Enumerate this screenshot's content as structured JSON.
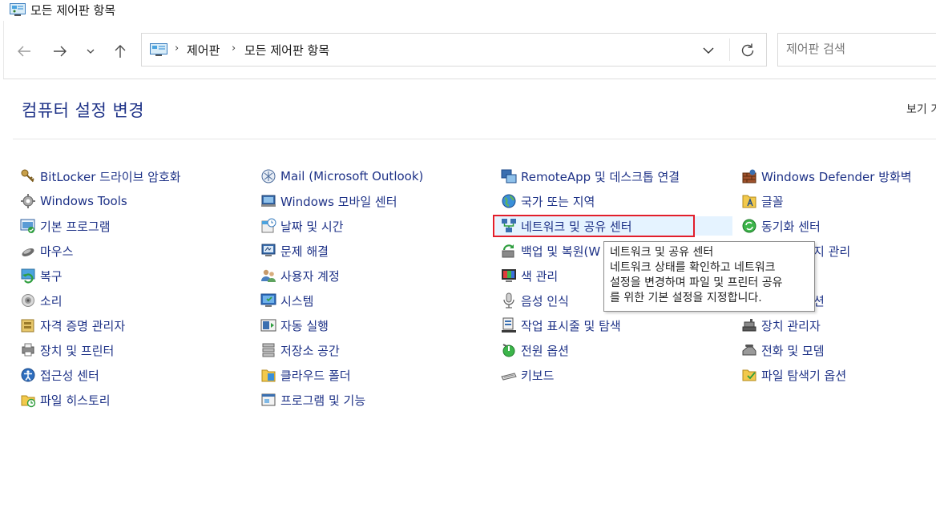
{
  "window": {
    "title": "모든 제어판 항목"
  },
  "address_bar": {
    "breadcrumbs": [
      "제어판",
      "모든 제어판 항목"
    ],
    "separator": "›"
  },
  "search": {
    "placeholder": "제어판 검색"
  },
  "page": {
    "heading": "컴퓨터 설정 변경",
    "view_by_label": "보기 기"
  },
  "columns": [
    {
      "items": [
        {
          "label": "BitLocker 드라이브 암호화",
          "icon": "bitlocker-key-icon"
        },
        {
          "label": "Windows Tools",
          "icon": "windows-tools-icon"
        },
        {
          "label": "기본 프로그램",
          "icon": "default-programs-icon"
        },
        {
          "label": "마우스",
          "icon": "mouse-icon"
        },
        {
          "label": "복구",
          "icon": "recovery-icon"
        },
        {
          "label": "소리",
          "icon": "sound-icon"
        },
        {
          "label": "자격 증명 관리자",
          "icon": "credential-manager-icon"
        },
        {
          "label": "장치 및 프린터",
          "icon": "devices-printers-icon"
        },
        {
          "label": "접근성 센터",
          "icon": "ease-of-access-icon"
        },
        {
          "label": "파일 히스토리",
          "icon": "file-history-icon"
        }
      ]
    },
    {
      "items": [
        {
          "label": "Mail (Microsoft Outlook)",
          "icon": "mail-icon"
        },
        {
          "label": "Windows 모바일 센터",
          "icon": "mobility-center-icon"
        },
        {
          "label": "날짜 및 시간",
          "icon": "date-time-icon"
        },
        {
          "label": "문제 해결",
          "icon": "troubleshooting-icon"
        },
        {
          "label": "사용자 계정",
          "icon": "user-accounts-icon"
        },
        {
          "label": "시스템",
          "icon": "system-icon"
        },
        {
          "label": "자동 실행",
          "icon": "autoplay-icon"
        },
        {
          "label": "저장소 공간",
          "icon": "storage-spaces-icon"
        },
        {
          "label": "클라우드 폴더",
          "icon": "cloud-folder-icon"
        },
        {
          "label": "프로그램 및 기능",
          "icon": "programs-features-icon"
        }
      ]
    },
    {
      "items": [
        {
          "label": "RemoteApp 및 데스크톱 연결",
          "icon": "remoteapp-icon"
        },
        {
          "label": "국가 또는 지역",
          "icon": "region-icon"
        },
        {
          "label": "네트워크 및 공유 센터",
          "icon": "network-sharing-icon"
        },
        {
          "label": "백업 및 복원(W",
          "icon": "backup-restore-icon"
        },
        {
          "label": "색 관리",
          "icon": "color-management-icon"
        },
        {
          "label": "음성 인식",
          "icon": "speech-recognition-icon"
        },
        {
          "label": "작업 표시줄 및 탐색",
          "icon": "taskbar-navigation-icon"
        },
        {
          "label": "전원 옵션",
          "icon": "power-options-icon"
        },
        {
          "label": "키보드",
          "icon": "keyboard-icon"
        }
      ]
    },
    {
      "items": [
        {
          "label": "Windows Defender 방화벽",
          "icon": "firewall-icon"
        },
        {
          "label": "글꼴",
          "icon": "fonts-icon"
        },
        {
          "label": "동기화 센터",
          "icon": "sync-center-icon"
        },
        {
          "label": "지 관리",
          "icon": "indexing-icon",
          "partial": true
        },
        {
          "label": "",
          "icon": "",
          "hidden": true
        },
        {
          "label": "션",
          "icon": "",
          "partial": true
        },
        {
          "label": "장치 관리자",
          "icon": "device-manager-icon"
        },
        {
          "label": "전화 및 모뎀",
          "icon": "phone-modem-icon"
        },
        {
          "label": "파일 탐색기 옵션",
          "icon": "file-explorer-options-icon"
        }
      ]
    }
  ],
  "tooltip": {
    "lines": [
      "네트워크 및 공유 센터",
      "네트워크 상태를 확인하고 네트워크",
      "설정을 변경하며 파일 및 프린터 공유",
      "를 위한 기본 설정을 지정합니다."
    ]
  },
  "colors": {
    "link": "#1e3287",
    "highlight_bg": "#e5f3ff",
    "annotation_red": "#e21e2b"
  }
}
